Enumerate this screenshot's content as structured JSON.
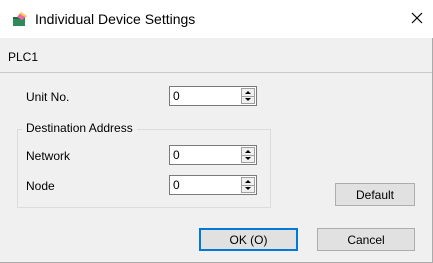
{
  "window": {
    "title": "Individual Device Settings",
    "close_glyph": "✕",
    "icon": "settings-app-icon"
  },
  "header": {
    "plc_name": "PLC1"
  },
  "form": {
    "unit_no": {
      "label": "Unit No.",
      "value": "0"
    },
    "destination": {
      "legend": "Destination Address",
      "network": {
        "label": "Network",
        "value": "0"
      },
      "node": {
        "label": "Node",
        "value": "0"
      }
    }
  },
  "buttons": {
    "default_label": "Default",
    "ok_label": "OK (O)",
    "cancel_label": "Cancel"
  },
  "colors": {
    "client_bg": "#f0f0f0",
    "focus_border": "#0078d7"
  }
}
